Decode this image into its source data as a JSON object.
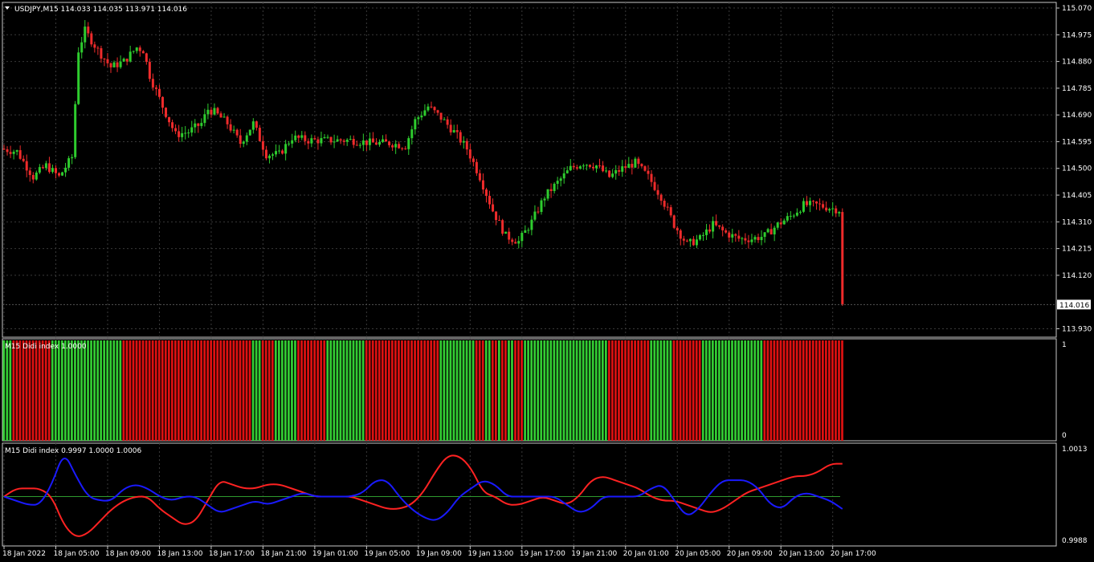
{
  "colors": {
    "background": "#000000",
    "grid": "#3a3a3a",
    "frame": "#c8c8c8",
    "bull": "#2ecc2e",
    "bear": "#ee2b2b",
    "histo_green": "#33cc33",
    "histo_red": "#dd1111",
    "line_red": "#ff2222",
    "line_blue": "#1a1aff",
    "line_mid": "#2e9a2e",
    "label_bg": "#ffffff"
  },
  "header": {
    "triangle_icon": "triangle-down-icon",
    "title": "USDJPY,M15  114.033 114.035 113.971 114.016"
  },
  "chart_data": [
    {
      "type": "candlestick",
      "symbol": "USDJPY,M15",
      "ohlc_readout": "114.033 114.035 113.971 114.016",
      "ylim": [
        113.9,
        115.09
      ],
      "yticks": [
        "115.070",
        "114.975",
        "114.880",
        "114.785",
        "114.690",
        "114.595",
        "114.500",
        "114.405",
        "114.310",
        "114.215",
        "114.120",
        "113.930"
      ],
      "ytick_values": [
        115.07,
        114.975,
        114.88,
        114.785,
        114.69,
        114.595,
        114.5,
        114.405,
        114.31,
        114.215,
        114.12,
        113.93
      ],
      "current_price": "114.016",
      "current_price_value": 114.016,
      "bar_count": 260,
      "close_path": [
        [
          0,
          114.57
        ],
        [
          5,
          114.56
        ],
        [
          10,
          114.47
        ],
        [
          14,
          114.51
        ],
        [
          18,
          114.47
        ],
        [
          22,
          114.54
        ],
        [
          24,
          114.92
        ],
        [
          26,
          114.99
        ],
        [
          30,
          114.92
        ],
        [
          34,
          114.86
        ],
        [
          38,
          114.88
        ],
        [
          42,
          114.93
        ],
        [
          44,
          114.92
        ],
        [
          46,
          114.83
        ],
        [
          50,
          114.72
        ],
        [
          54,
          114.62
        ],
        [
          58,
          114.63
        ],
        [
          62,
          114.66
        ],
        [
          64,
          114.71
        ],
        [
          66,
          114.7
        ],
        [
          70,
          114.66
        ],
        [
          74,
          114.59
        ],
        [
          78,
          114.66
        ],
        [
          82,
          114.55
        ],
        [
          86,
          114.55
        ],
        [
          90,
          114.61
        ],
        [
          95,
          114.6
        ],
        [
          100,
          114.6
        ],
        [
          108,
          114.6
        ],
        [
          115,
          114.59
        ],
        [
          120,
          114.59
        ],
        [
          125,
          114.58
        ],
        [
          128,
          114.67
        ],
        [
          132,
          114.72
        ],
        [
          136,
          114.68
        ],
        [
          140,
          114.63
        ],
        [
          144,
          114.57
        ],
        [
          148,
          114.47
        ],
        [
          152,
          114.35
        ],
        [
          156,
          114.26
        ],
        [
          160,
          114.24
        ],
        [
          164,
          114.31
        ],
        [
          168,
          114.4
        ],
        [
          172,
          114.45
        ],
        [
          176,
          114.5
        ],
        [
          180,
          114.52
        ],
        [
          184,
          114.51
        ],
        [
          188,
          114.47
        ],
        [
          192,
          114.5
        ],
        [
          196,
          114.52
        ],
        [
          200,
          114.47
        ],
        [
          204,
          114.4
        ],
        [
          208,
          114.3
        ],
        [
          212,
          114.23
        ],
        [
          216,
          114.25
        ],
        [
          220,
          114.3
        ],
        [
          224,
          114.27
        ],
        [
          228,
          114.25
        ],
        [
          232,
          114.25
        ],
        [
          236,
          114.26
        ],
        [
          240,
          114.3
        ],
        [
          244,
          114.33
        ],
        [
          248,
          114.37
        ],
        [
          252,
          114.37
        ],
        [
          256,
          114.36
        ],
        [
          260,
          114.35
        ]
      ],
      "x_tick_labels": [
        "18 Jan 2022",
        "18 Jan 05:00",
        "18 Jan 09:00",
        "18 Jan 13:00",
        "18 Jan 17:00",
        "18 Jan 21:00",
        "19 Jan 01:00",
        "19 Jan 05:00",
        "19 Jan 09:00",
        "19 Jan 13:00",
        "19 Jan 17:00",
        "19 Jan 21:00",
        "20 Jan 01:00",
        "20 Jan 05:00",
        "20 Jan 09:00",
        "20 Jan 13:00",
        "20 Jan 17:00"
      ],
      "grid": true
    },
    {
      "type": "bar",
      "title": "M15 Didi index 1.0000",
      "ylim": [
        0,
        1
      ],
      "yticks": [
        "1",
        "0"
      ],
      "segments": [
        {
          "from": 0,
          "to": 3,
          "color": "green"
        },
        {
          "from": 3,
          "to": 15,
          "color": "red"
        },
        {
          "from": 15,
          "to": 37,
          "color": "green"
        },
        {
          "from": 37,
          "to": 77,
          "color": "red"
        },
        {
          "from": 77,
          "to": 80,
          "color": "green"
        },
        {
          "from": 80,
          "to": 84,
          "color": "red"
        },
        {
          "from": 84,
          "to": 91,
          "color": "green"
        },
        {
          "from": 91,
          "to": 100,
          "color": "red"
        },
        {
          "from": 100,
          "to": 112,
          "color": "green"
        },
        {
          "from": 112,
          "to": 135,
          "color": "red"
        },
        {
          "from": 135,
          "to": 146,
          "color": "green"
        },
        {
          "from": 146,
          "to": 149,
          "color": "red"
        },
        {
          "from": 149,
          "to": 151,
          "color": "green"
        },
        {
          "from": 151,
          "to": 153,
          "color": "red"
        },
        {
          "from": 153,
          "to": 154,
          "color": "green"
        },
        {
          "from": 154,
          "to": 156,
          "color": "red"
        },
        {
          "from": 156,
          "to": 158,
          "color": "green"
        },
        {
          "from": 158,
          "to": 161,
          "color": "red"
        },
        {
          "from": 161,
          "to": 187,
          "color": "green"
        },
        {
          "from": 187,
          "to": 200,
          "color": "red"
        },
        {
          "from": 200,
          "to": 207,
          "color": "green"
        },
        {
          "from": 207,
          "to": 216,
          "color": "red"
        },
        {
          "from": 216,
          "to": 235,
          "color": "green"
        },
        {
          "from": 235,
          "to": 260,
          "color": "red"
        }
      ]
    },
    {
      "type": "line",
      "title": "M15 Didi index 0.9997 1.0000 1.0006",
      "ylim": [
        0.9988,
        1.0013
      ],
      "yticks": [
        "1.0013",
        "0.9988"
      ],
      "mid_value": 1.0,
      "series": [
        {
          "color": "red",
          "values": [
            1.0,
            1.0002,
            1.0002,
            1.0002,
            1.0,
            0.9993,
            0.999,
            0.9991,
            0.9994,
            0.9997,
            0.9999,
            1.0,
            1.0,
            0.9997,
            0.9995,
            0.9993,
            0.9994,
            0.9999,
            1.0004,
            1.0003,
            1.0002,
            1.0002,
            1.0003,
            1.0003,
            1.0002,
            1.0001,
            1.0,
            1.0,
            1.0,
            1.0,
            0.9999,
            0.9998,
            0.9997,
            0.9997,
            0.9998,
            1.0001,
            1.0006,
            1.001,
            1.001,
            1.0007,
            1.0001,
            1.0,
            0.9998,
            0.9998,
            0.9999,
            1.0,
            0.9999,
            0.9998,
            1.0,
            1.0004,
            1.0005,
            1.0004,
            1.0003,
            1.0002,
            1.0,
            0.9999,
            0.9999,
            0.9998,
            0.9997,
            0.9996,
            0.9997,
            0.9999,
            1.0001,
            1.0002,
            1.0003,
            1.0004,
            1.0005,
            1.0005,
            1.0006,
            1.0008,
            1.0008
          ]
        },
        {
          "color": "blue",
          "values": [
            1.0,
            0.9999,
            0.9998,
            0.9998,
            1.0003,
            1.0011,
            1.0005,
            1.0,
            0.9999,
            0.9999,
            1.0002,
            1.0003,
            1.0002,
            1.0,
            0.9999,
            1.0,
            1.0,
            0.9998,
            0.9996,
            0.9997,
            0.9998,
            0.9999,
            0.9998,
            0.9999,
            1.0,
            1.0001,
            1.0,
            1.0,
            1.0,
            1.0,
            1.0001,
            1.0004,
            1.0004,
            1.0,
            0.9997,
            0.9995,
            0.9994,
            0.9996,
            1.0,
            1.0002,
            1.0004,
            1.0003,
            1.0,
            1.0,
            1.0,
            1.0,
            1.0,
            0.9998,
            0.9996,
            0.9997,
            1.0,
            1.0,
            1.0,
            1.0,
            1.0002,
            1.0003,
            0.9999,
            0.9995,
            0.9997,
            1.0001,
            1.0004,
            1.0004,
            1.0004,
            1.0002,
            0.9998,
            0.9997,
            1.0,
            1.0001,
            1.0,
            0.9999,
            0.9997
          ]
        }
      ]
    }
  ]
}
